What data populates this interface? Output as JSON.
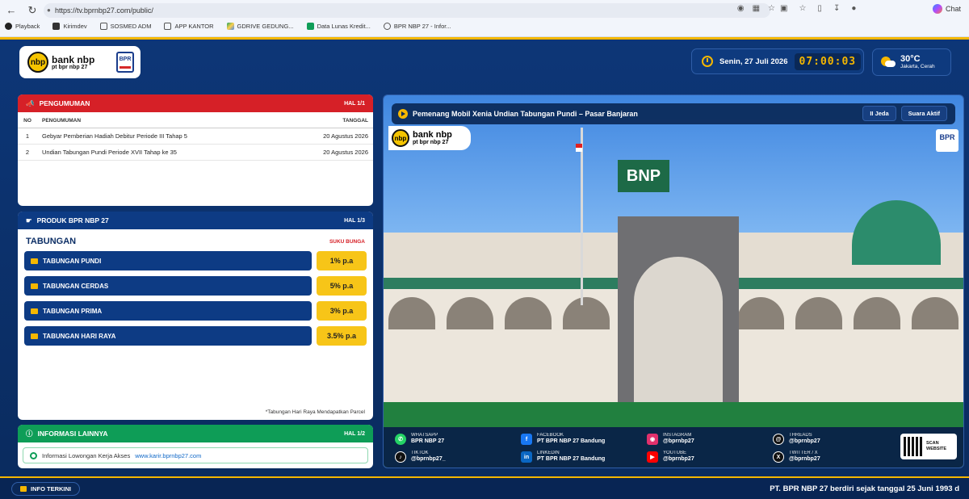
{
  "browser": {
    "url": "https://tv.bprnbp27.com/public/",
    "chat_label": "Chat",
    "bookmarks": [
      "Playback",
      "Kirimdev",
      "SOSMED ADM",
      "APP KANTOR",
      "GDRIVE GEDUNG...",
      "Data Lunas Kredit...",
      "BPR NBP 27 - Infor..."
    ]
  },
  "header": {
    "brand_line1": "bank nbp",
    "brand_line2": "pt bpr nbp 27",
    "logo_mark": "nbp",
    "bpr_mark": "BPR",
    "date": "Senin, 27 Juli 2026",
    "time": "07:00:03",
    "temperature": "30°C",
    "city": "Jakarta, Cerah"
  },
  "announcements": {
    "title": "PENGUMUMAN",
    "page": "HAL 1/1",
    "columns": [
      "NO",
      "PENGUMUMAN",
      "TANGGAL"
    ],
    "rows": [
      {
        "no": "1",
        "text": "Gebyar Pemberian Hadiah Debitur Periode III Tahap 5",
        "date": "20 Agustus 2026"
      },
      {
        "no": "2",
        "text": "Undian Tabungan Pundi Periode XVII Tahap ke 35",
        "date": "20 Agustus 2026"
      }
    ]
  },
  "products": {
    "title": "PRODUK BPR NBP 27",
    "page": "HAL 1/3",
    "category": "TABUNGAN",
    "rate_label": "SUKU BUNGA",
    "items": [
      {
        "name": "TABUNGAN PUNDI",
        "rate": "1% p.a"
      },
      {
        "name": "TABUNGAN CERDAS",
        "rate": "5% p.a"
      },
      {
        "name": "TABUNGAN PRIMA",
        "rate": "3% p.a"
      },
      {
        "name": "TABUNGAN HARI RAYA",
        "rate": "3.5% p.a"
      }
    ],
    "note": "*Tabungan Hari Raya Mendapatkan Parcel"
  },
  "info": {
    "title": "INFORMASI LAINNYA",
    "page": "HAL 1/2",
    "text": "Informasi Lowongan Kerja Akses",
    "link": "www.karir.bprnbp27.com"
  },
  "video": {
    "title": "Pemenang Mobil Xenia Undian Tabungan Pundi – Pasar Banjaran",
    "pause_label": "II Jeda",
    "sound_label": "Suara Aktif",
    "sign_text": "BNP"
  },
  "social": [
    {
      "network": "WHATSAPP",
      "handle": "BPR NBP 27",
      "icon": "whatsapp-icon",
      "color": "#25d366"
    },
    {
      "network": "FACEBOOK",
      "handle": "PT BPR NBP 27 Bandung",
      "icon": "facebook-icon",
      "color": "#1877f2"
    },
    {
      "network": "INSTAGRAM",
      "handle": "@bprnbp27",
      "icon": "instagram-icon",
      "color": "#e1306c"
    },
    {
      "network": "THREADS",
      "handle": "@bprnbp27",
      "icon": "threads-icon",
      "color": "#111111"
    },
    {
      "network": "TIKTOK",
      "handle": "@bprnbp27_",
      "icon": "tiktok-icon",
      "color": "#111111"
    },
    {
      "network": "LINKEDIN",
      "handle": "PT BPR NBP 27 Bandung",
      "icon": "linkedin-icon",
      "color": "#0a66c2"
    },
    {
      "network": "YOUTUBE",
      "handle": "@bprnbp27",
      "icon": "youtube-icon",
      "color": "#ff0000"
    },
    {
      "network": "TWITTER / X",
      "handle": "@bprnbp27",
      "icon": "x-icon",
      "color": "#111111"
    }
  ],
  "scan": {
    "line1": "SCAN",
    "line2": "WEBSITE"
  },
  "ticker": {
    "label": "INFO TERKINI",
    "text": "PT. BPR NBP 27 berdiri sejak tanggal 25 Juni 1993 d"
  }
}
